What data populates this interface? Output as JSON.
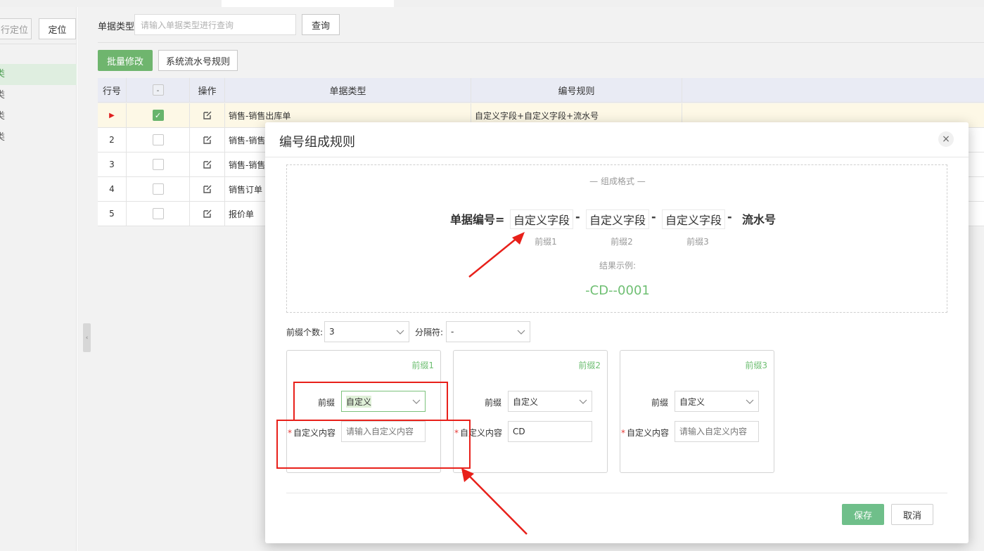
{
  "left_panel": {
    "partial_button_label": "行定位",
    "locate_button_label": "定位",
    "tree_items": [
      "类",
      "类",
      "类",
      "类"
    ]
  },
  "toolbar": {
    "search_label": "单据类型",
    "search_placeholder": "请输入单据类型进行查询",
    "query_label": "查询",
    "batch_edit_label": "批量修改",
    "serial_rule_label": "系统流水号规则"
  },
  "table": {
    "headers": [
      "行号",
      "",
      "操作",
      "单据类型",
      "编号规则"
    ],
    "rows": [
      {
        "no": "",
        "checked": true,
        "type": "销售-销售出库单",
        "rule": "自定义字段+自定义字段+流水号"
      },
      {
        "no": "2",
        "checked": false,
        "type": "销售-销售",
        "rule": ""
      },
      {
        "no": "3",
        "checked": false,
        "type": "销售-销售",
        "rule": ""
      },
      {
        "no": "4",
        "checked": false,
        "type": "销售订单",
        "rule": ""
      },
      {
        "no": "5",
        "checked": false,
        "type": "报价单",
        "rule": ""
      }
    ]
  },
  "modal": {
    "title": "编号组成规则",
    "close_glyph": "×",
    "format_title": "— 组成格式 —",
    "formula_label": "单据编号=",
    "segments": [
      "自定义字段",
      "自定义字段",
      "自定义字段"
    ],
    "separator": "-",
    "serial_label": "流水号",
    "segment_captions": [
      "前缀1",
      "前缀2",
      "前缀3"
    ],
    "result_label": "结果示例:",
    "result_value": "-CD--0001",
    "prefix_count_label": "前缀个数:",
    "prefix_count_value": "3",
    "separator_label": "分隔符:",
    "separator_value": "-",
    "cards": [
      {
        "title": "前缀1",
        "prefix_label": "前缀",
        "prefix_value": "自定义",
        "content_label": "自定义内容",
        "content_value": "",
        "content_placeholder": "请输入自定义内容"
      },
      {
        "title": "前缀2",
        "prefix_label": "前缀",
        "prefix_value": "自定义",
        "content_label": "自定义内容",
        "content_value": "CD",
        "content_placeholder": "请输入自定义内容"
      },
      {
        "title": "前缀3",
        "prefix_label": "前缀",
        "prefix_value": "自定义",
        "content_label": "自定义内容",
        "content_value": "",
        "content_placeholder": "请输入自定义内容"
      }
    ],
    "required_mark": "*",
    "save_label": "保存",
    "cancel_label": "取消"
  },
  "colors": {
    "accent_green": "#6fb56e",
    "annotation_red": "#e8201a"
  }
}
